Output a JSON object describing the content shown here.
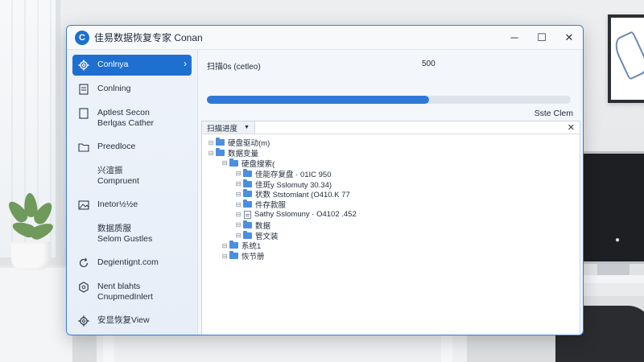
{
  "window": {
    "title": "佳易数据恢复专家 Conan",
    "controls": [
      "─",
      "☐",
      "✕"
    ]
  },
  "sidebar": {
    "items": [
      {
        "icon": "gear-icon",
        "label": "Conlnya",
        "active": true
      },
      {
        "icon": "document-icon",
        "label": "Conlning",
        "active": false
      },
      {
        "icon": "document-icon",
        "label": "Aptlest Secon\nBerlgas Cather",
        "active": false
      },
      {
        "icon": "folder-icon",
        "label": "Preedloce",
        "active": false
      },
      {
        "icon": "none",
        "label": "兴渲振\nCompruent",
        "active": false
      },
      {
        "icon": "image-icon",
        "label": "Inetor½½e",
        "active": false
      },
      {
        "icon": "none",
        "label": "数据质服\nSelom Gustles",
        "active": false
      },
      {
        "icon": "refresh-icon",
        "label": "Degientignt.com",
        "active": false
      },
      {
        "icon": "gear-icon",
        "label": "Nent blahts\nCnupmedInlert",
        "active": false
      },
      {
        "icon": "gear-icon",
        "label": "安显恢复View",
        "active": false
      }
    ]
  },
  "scan": {
    "label": "扫描0s  (cetleo)",
    "count": "500",
    "progress_fraction": 0.61,
    "status_right": "Sste Clem"
  },
  "tree_panel": {
    "dropdown_label": "扫描进度",
    "close_label": "✕",
    "footer_label": "+",
    "rows": [
      {
        "depth": 0,
        "expander": "⊟",
        "kind": "folder",
        "label": "硬盘驱动(m)"
      },
      {
        "depth": 0,
        "expander": "⊟",
        "kind": "folder",
        "label": "数据变量"
      },
      {
        "depth": 1,
        "expander": "⊟",
        "kind": "folder",
        "label": "硬盘搜索("
      },
      {
        "depth": 2,
        "expander": "⊟",
        "kind": "folder",
        "label": "佳能存复盘 · 01IC 950"
      },
      {
        "depth": 2,
        "expander": "⊟",
        "kind": "folder",
        "label": "佳斑y Sslomuty  30.34)"
      },
      {
        "depth": 2,
        "expander": "⊟",
        "kind": "folder",
        "label": "状数 Ststomlant  (O410.K 77"
      },
      {
        "depth": 2,
        "expander": "⊟",
        "kind": "folder",
        "label": "件存款服"
      },
      {
        "depth": 2,
        "expander": "⊟",
        "kind": "file",
        "label": "Sathy Sslomuny  · O4102 .452"
      },
      {
        "depth": 2,
        "expander": "⊟",
        "kind": "folder",
        "label": "数据"
      },
      {
        "depth": 2,
        "expander": "⊟",
        "kind": "folder",
        "label": "管文装"
      },
      {
        "depth": 1,
        "expander": "⊟",
        "kind": "folder",
        "label": "系统1"
      },
      {
        "depth": 1,
        "expander": "⊟",
        "kind": "folder",
        "label": "恢节册"
      }
    ]
  }
}
